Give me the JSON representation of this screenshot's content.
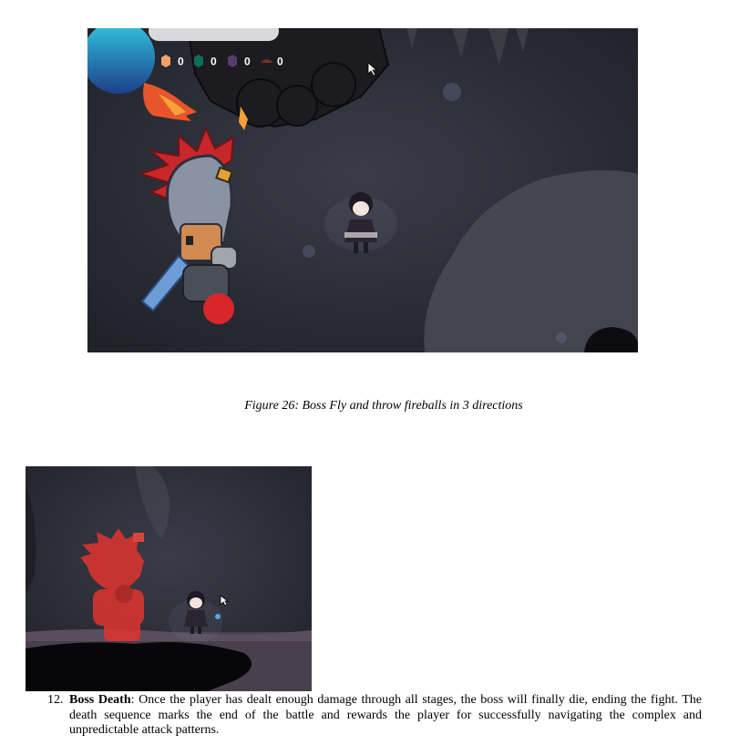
{
  "figure1": {
    "hud": {
      "counters": [
        {
          "icon": "orange-gem-icon",
          "color": "#f2a36b",
          "value": "0"
        },
        {
          "icon": "teal-gem-icon",
          "color": "#0f6e5a",
          "value": "0"
        },
        {
          "icon": "purple-gem-icon",
          "color": "#5b3a6e",
          "value": "0"
        },
        {
          "icon": "red-leaf-icon",
          "color": "#7a2a22",
          "value": "0"
        }
      ]
    },
    "caption": "Figure 26: Boss Fly and throw fireballs in 3 directions"
  },
  "list_item": {
    "number": "12.",
    "term": "Boss Death",
    "text": ": Once the player has dealt enough damage through all stages, the boss will finally die, ending the fight. The death sequence marks the end of the battle and rewards the player for successfully navigating the complex and unpredictable attack patterns."
  },
  "colors": {
    "cave_background": "#2a2b34",
    "boss_hair": "#c7272a",
    "boss_death_tint": "#e0342f",
    "health_orb": "#2fb8d8"
  }
}
